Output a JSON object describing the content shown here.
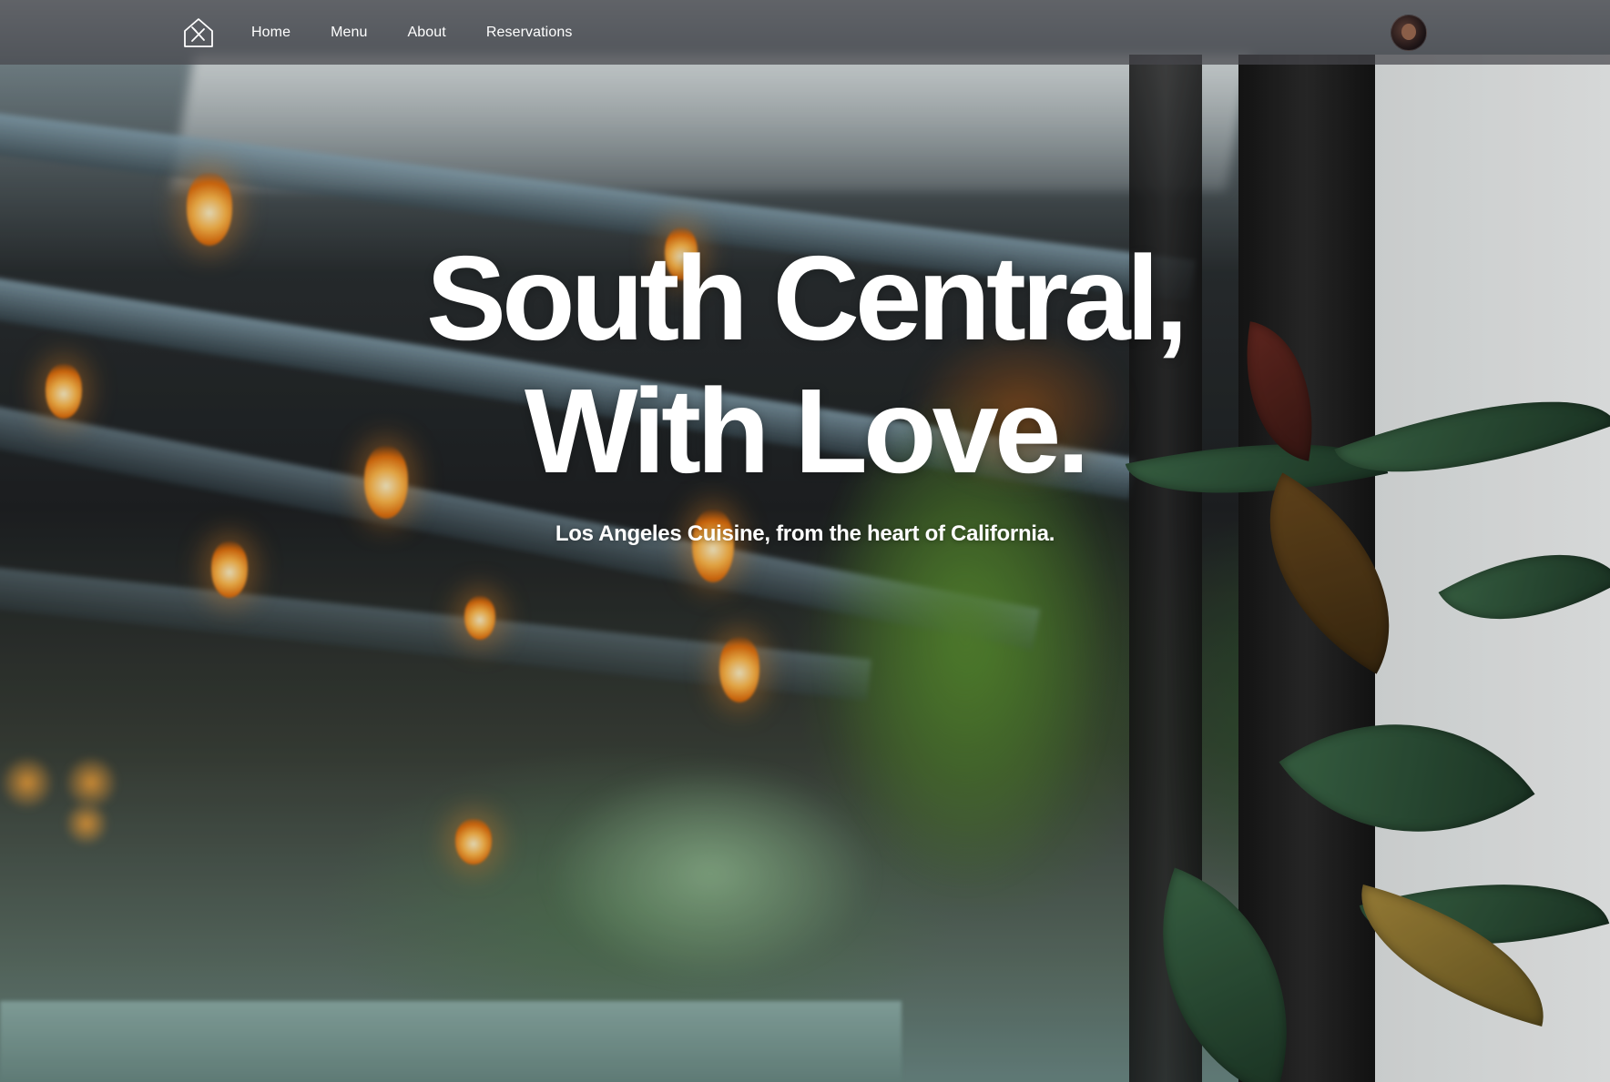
{
  "nav": {
    "logo_icon": "restaurant-house-utensils-icon",
    "links": [
      {
        "label": "Home"
      },
      {
        "label": "Menu"
      },
      {
        "label": "About"
      },
      {
        "label": "Reservations"
      }
    ],
    "avatar": "user-avatar"
  },
  "hero": {
    "headline_line1": "South Central,",
    "headline_line2": "With Love.",
    "tagline": "Los Angeles Cuisine, from the heart of California.",
    "background_image": "blurred restaurant patio with string lights and plants"
  },
  "colors": {
    "nav_bg": "#46464c",
    "text": "#ffffff",
    "bulb": "#ffb84a"
  }
}
